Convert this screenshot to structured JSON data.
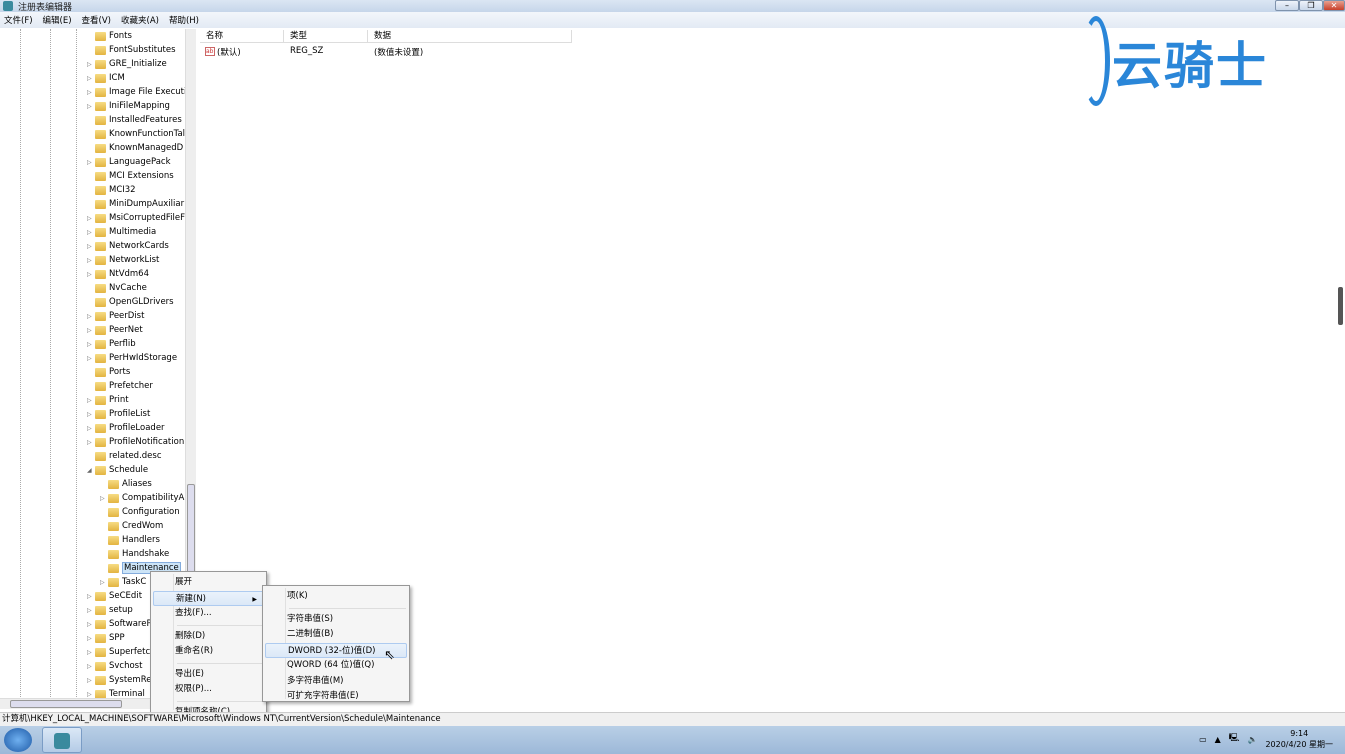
{
  "window": {
    "title": "注册表编辑器",
    "minimize": "–",
    "restore": "❐",
    "close": "✕"
  },
  "menubar": [
    "文件(F)",
    "编辑(E)",
    "查看(V)",
    "收藏夹(A)",
    "帮助(H)"
  ],
  "tree": [
    {
      "label": "Fonts",
      "level": 1,
      "exp": false
    },
    {
      "label": "FontSubstitutes",
      "level": 1,
      "exp": false
    },
    {
      "label": "GRE_Initialize",
      "level": 1,
      "exp": true
    },
    {
      "label": "ICM",
      "level": 1,
      "exp": true
    },
    {
      "label": "Image File Executi",
      "level": 1,
      "exp": true
    },
    {
      "label": "IniFileMapping",
      "level": 1,
      "exp": true
    },
    {
      "label": "InstalledFeatures",
      "level": 1,
      "exp": false
    },
    {
      "label": "KnownFunctionTal",
      "level": 1,
      "exp": false
    },
    {
      "label": "KnownManagedD",
      "level": 1,
      "exp": false
    },
    {
      "label": "LanguagePack",
      "level": 1,
      "exp": true
    },
    {
      "label": "MCI Extensions",
      "level": 1,
      "exp": false
    },
    {
      "label": "MCI32",
      "level": 1,
      "exp": false
    },
    {
      "label": "MiniDumpAuxiliar",
      "level": 1,
      "exp": false
    },
    {
      "label": "MsiCorruptedFileF",
      "level": 1,
      "exp": true
    },
    {
      "label": "Multimedia",
      "level": 1,
      "exp": true
    },
    {
      "label": "NetworkCards",
      "level": 1,
      "exp": true
    },
    {
      "label": "NetworkList",
      "level": 1,
      "exp": true
    },
    {
      "label": "NtVdm64",
      "level": 1,
      "exp": true
    },
    {
      "label": "NvCache",
      "level": 1,
      "exp": false
    },
    {
      "label": "OpenGLDrivers",
      "level": 1,
      "exp": false
    },
    {
      "label": "PeerDist",
      "level": 1,
      "exp": true
    },
    {
      "label": "PeerNet",
      "level": 1,
      "exp": true
    },
    {
      "label": "Perflib",
      "level": 1,
      "exp": true
    },
    {
      "label": "PerHwIdStorage",
      "level": 1,
      "exp": true
    },
    {
      "label": "Ports",
      "level": 1,
      "exp": false
    },
    {
      "label": "Prefetcher",
      "level": 1,
      "exp": false
    },
    {
      "label": "Print",
      "level": 1,
      "exp": true
    },
    {
      "label": "ProfileList",
      "level": 1,
      "exp": true
    },
    {
      "label": "ProfileLoader",
      "level": 1,
      "exp": true
    },
    {
      "label": "ProfileNotification",
      "level": 1,
      "exp": true
    },
    {
      "label": "related.desc",
      "level": 1,
      "exp": false
    },
    {
      "label": "Schedule",
      "level": 1,
      "exp": "open"
    },
    {
      "label": "Aliases",
      "level": 2,
      "exp": false
    },
    {
      "label": "CompatibilityA",
      "level": 2,
      "exp": true
    },
    {
      "label": "Configuration",
      "level": 2,
      "exp": false
    },
    {
      "label": "CredWom",
      "level": 2,
      "exp": false
    },
    {
      "label": "Handlers",
      "level": 2,
      "exp": false
    },
    {
      "label": "Handshake",
      "level": 2,
      "exp": false
    },
    {
      "label": "Maintenance",
      "level": 2,
      "exp": false,
      "selected": true
    },
    {
      "label": "TaskC",
      "level": 2,
      "exp": true
    },
    {
      "label": "SeCEdit",
      "level": 1,
      "exp": true
    },
    {
      "label": "setup",
      "level": 1,
      "exp": true
    },
    {
      "label": "SoftwareP",
      "level": 1,
      "exp": true
    },
    {
      "label": "SPP",
      "level": 1,
      "exp": true
    },
    {
      "label": "Superfetc",
      "level": 1,
      "exp": true
    },
    {
      "label": "Svchost",
      "level": 1,
      "exp": true
    },
    {
      "label": "SystemRe",
      "level": 1,
      "exp": true
    },
    {
      "label": "Terminal",
      "level": 1,
      "exp": true
    }
  ],
  "list": {
    "columns": [
      "名称",
      "类型",
      "数据"
    ],
    "rows": [
      {
        "name": "(默认)",
        "type": "REG_SZ",
        "data": "(数值未设置)"
      }
    ]
  },
  "logo_text": "云骑士",
  "context_menu": [
    {
      "label": "展开"
    },
    {
      "label": "新建(N)",
      "submenu": true,
      "highlighted": true
    },
    {
      "label": "查找(F)..."
    },
    {
      "sep": true
    },
    {
      "label": "删除(D)"
    },
    {
      "label": "重命名(R)"
    },
    {
      "sep": true
    },
    {
      "label": "导出(E)"
    },
    {
      "label": "权限(P)..."
    },
    {
      "sep": true
    },
    {
      "label": "复制项名称(C)"
    }
  ],
  "submenu": [
    {
      "label": "项(K)"
    },
    {
      "sep": true
    },
    {
      "label": "字符串值(S)"
    },
    {
      "label": "二进制值(B)"
    },
    {
      "label": "DWORD (32-位)值(D)",
      "highlighted": true
    },
    {
      "label": "QWORD (64 位)值(Q)"
    },
    {
      "label": "多字符串值(M)"
    },
    {
      "label": "可扩充字符串值(E)"
    }
  ],
  "status": "计算机\\HKEY_LOCAL_MACHINE\\SOFTWARE\\Microsoft\\Windows NT\\CurrentVersion\\Schedule\\Maintenance",
  "taskbar": {
    "time": "9:14",
    "date": "2020/4/20 星期一"
  }
}
